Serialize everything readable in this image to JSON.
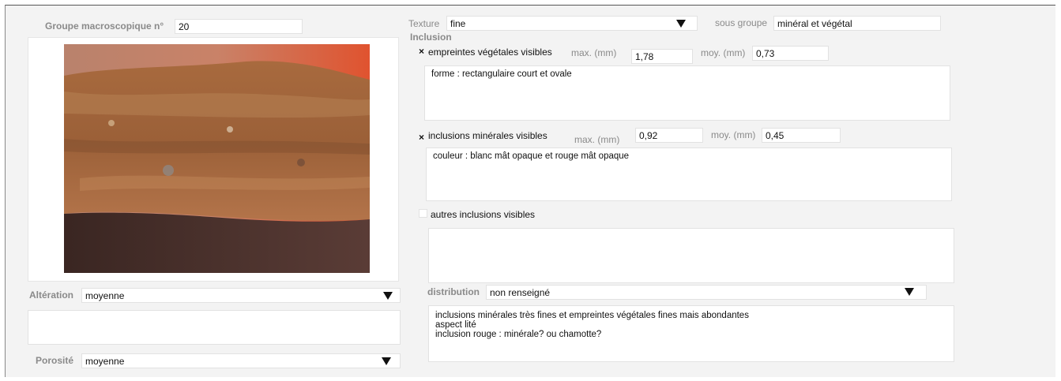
{
  "groupe": {
    "label": "Groupe macroscopique n°",
    "value": "20"
  },
  "texture": {
    "label": "Texture",
    "value": "fine"
  },
  "sous_groupe": {
    "label": "sous groupe",
    "value": "minéral et végétal"
  },
  "inclusion_title": "Inclusion",
  "vegetales": {
    "checked_mark": "×",
    "label": "empreintes végétales visibles",
    "max_label": "max. (mm)",
    "max_value": "1,78",
    "moy_label": "moy. (mm)",
    "moy_value": "0,73",
    "note": "forme : rectangulaire court et ovale"
  },
  "minerales": {
    "checked_mark": "×",
    "label": "inclusions minérales visibles",
    "max_label": "max. (mm)",
    "max_value": "0,92",
    "moy_label": "moy. (mm)",
    "moy_value": "0,45",
    "note": "couleur : blanc mât opaque et rouge mât opaque"
  },
  "autres": {
    "label": "autres inclusions visibles",
    "note": ""
  },
  "distribution": {
    "label": "distribution",
    "value": "non renseigné"
  },
  "commentaire": "inclusions minérales très fines et empreintes végétales fines mais abondantes\naspect lité\ninclusion rouge : minérale? ou chamotte?",
  "alteration": {
    "label": "Altération",
    "value": "moyenne",
    "note": ""
  },
  "porosite": {
    "label": "Porosité",
    "value": "moyenne"
  },
  "icons": {
    "dropdown": "dropdown-arrow-icon",
    "check": "checkmark-icon"
  },
  "colors": {
    "panel": "#f3f3f3",
    "label": "#8a8a8a",
    "field": "#ffffff"
  }
}
